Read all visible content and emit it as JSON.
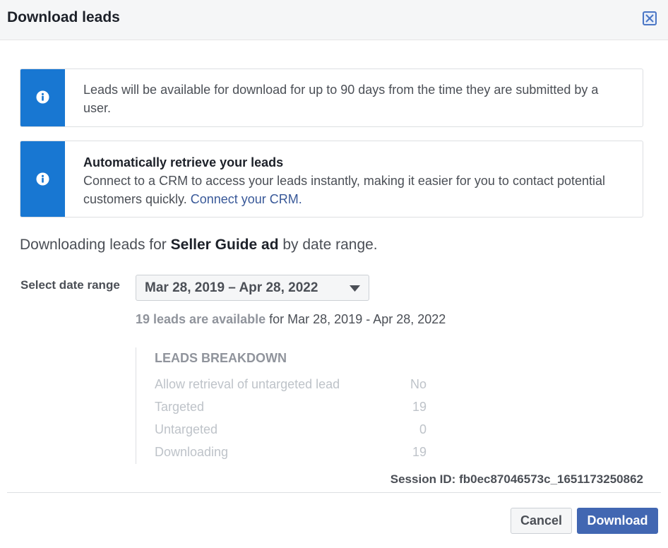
{
  "dialog": {
    "title": "Download leads",
    "close_icon": "close-icon"
  },
  "notices": {
    "retention": {
      "icon": "info-icon",
      "text": "Leads will be available for download for up to 90 days from the time they are submitted by a user."
    },
    "crm": {
      "icon": "info-icon",
      "heading": "Automatically retrieve your leads",
      "text": "Connect to a CRM to access your leads instantly, making it easier for you to contact potential customers quickly. ",
      "link": "Connect your CRM."
    }
  },
  "downloading": {
    "prefix": "Downloading leads for ",
    "ad_name": "Seller Guide ad",
    "suffix": " by date range."
  },
  "date_range": {
    "label": "Select date range",
    "selected": "Mar 28, 2019 – Apr 28, 2022",
    "caret_icon": "caret-down-icon"
  },
  "availability": {
    "count_text": "19 leads are available",
    "range_text": " for Mar 28, 2019 - Apr 28, 2022"
  },
  "breakdown": {
    "title": "LEADS BREAKDOWN",
    "rows": [
      {
        "label": "Allow retrieval of untargeted lead",
        "value": "No"
      },
      {
        "label": "Targeted",
        "value": "19"
      },
      {
        "label": "Untargeted",
        "value": "0"
      },
      {
        "label": "Downloading",
        "value": "19"
      }
    ]
  },
  "session": {
    "text": "Session ID: fb0ec87046573c_1651173250862"
  },
  "footer": {
    "cancel_label": "Cancel",
    "download_label": "Download"
  },
  "colors": {
    "accent_blue": "#1877d2",
    "button_blue": "#4267b2",
    "link_blue": "#385898"
  }
}
